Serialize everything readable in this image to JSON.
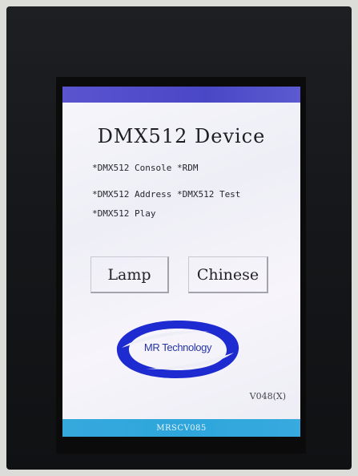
{
  "screen": {
    "title": "DMX512 Device",
    "menu": {
      "line1": "*DMX512 Console *RDM",
      "line2": "*DMX512 Address *DMX512 Test",
      "line3": "*DMX512 Play"
    },
    "buttons": {
      "lamp": "Lamp",
      "chinese": "Chinese"
    },
    "logo": {
      "text": "MR Technology"
    },
    "version": "V048(X)",
    "footer": "MRSCV085"
  },
  "colors": {
    "top_bar": "#4a47c6",
    "bottom_bar": "#2ea6db",
    "logo_blue": "#1d2bd0",
    "bezel": "#15171a"
  }
}
